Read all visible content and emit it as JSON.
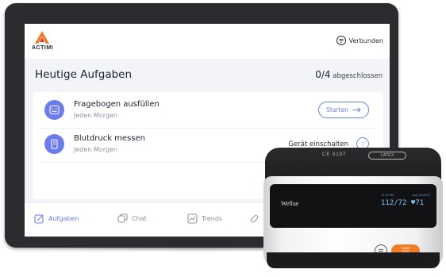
{
  "app": {
    "logo_text": "ACTIMI",
    "connection_label": "Verbunden"
  },
  "header": {
    "title": "Heutige Aufgaben",
    "progress_count": "0/4",
    "progress_suffix": "abgeschlossen"
  },
  "tasks": [
    {
      "title": "Fragebogen ausfüllen",
      "subtitle": "Jeden Morgen",
      "action_label": "Starten",
      "icon": "questionnaire-icon"
    },
    {
      "title": "Blutdruck messen",
      "subtitle": "Jeden Morgen",
      "status_text": "Gerät einschalten",
      "icon": "blood-pressure-icon"
    }
  ],
  "bottom_nav": {
    "items": [
      {
        "label": "Aufgaben",
        "icon": "tasks-icon",
        "active": true
      },
      {
        "label": "Chat",
        "icon": "chat-icon",
        "active": false
      },
      {
        "label": "Trends",
        "icon": "trends-icon",
        "active": false
      }
    ]
  },
  "device": {
    "brand": "Wellue",
    "cuff_code": "CE 0197",
    "cuff_tag": "LATEX",
    "time": "11:21 PM",
    "date": "Aug 15/2022",
    "reading": "112/72 ♥71",
    "start_label_1": "START",
    "start_label_2": "STOP"
  },
  "colors": {
    "accent": "#6b7cf0",
    "device_button": "#ef7d28",
    "logo_orange": "#f47a20",
    "logo_red": "#e0342b"
  }
}
